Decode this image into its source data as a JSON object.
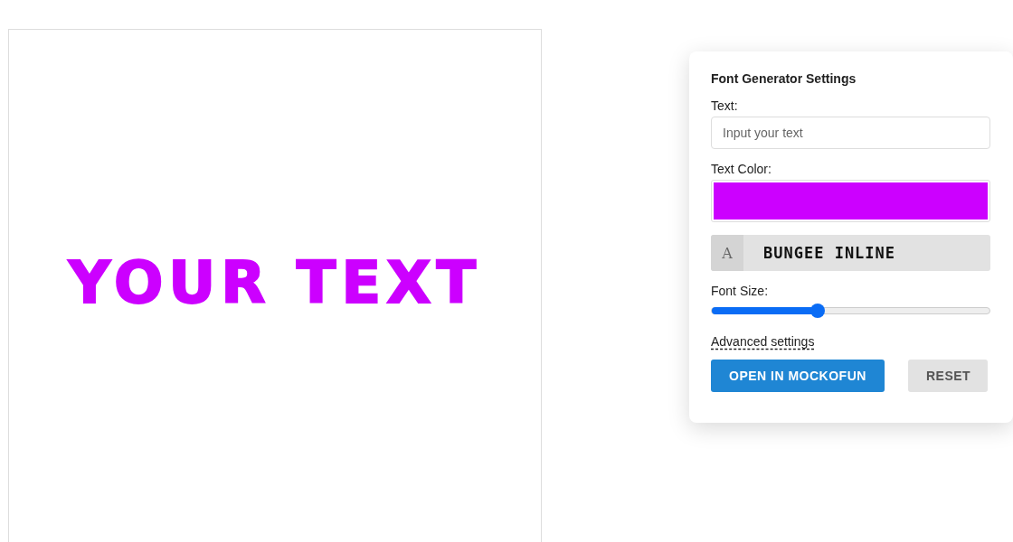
{
  "preview": {
    "text": "YOUR TEXT"
  },
  "settings": {
    "title": "Font Generator Settings",
    "text_label": "Text:",
    "text_placeholder": "Input your text",
    "color_label": "Text Color:",
    "color_field": {
      "color": "#cc00ff"
    },
    "font_icon": "A",
    "font_name": "BUNGEE INLINE",
    "size_label": "Font Size:",
    "size": {
      "level": 0.38
    },
    "advanced_link": "Advanced settings",
    "buttons": [
      {
        "label": "OPEN IN MOCKOFUN",
        "kind": "primary"
      },
      {
        "label": "RESET",
        "kind": "secondary"
      }
    ]
  }
}
